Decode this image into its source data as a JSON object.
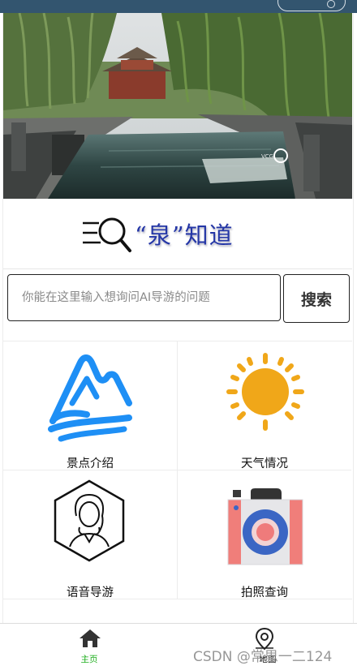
{
  "logo": {
    "text": "“泉”知道"
  },
  "search": {
    "placeholder": "你能在这里输入想询问AI导游的问题",
    "button_label": "搜索"
  },
  "features": [
    {
      "label": "景点介绍",
      "icon": "mountain-icon"
    },
    {
      "label": "天气情况",
      "icon": "sun-icon"
    },
    {
      "label": "语音导游",
      "icon": "guide-avatar-icon"
    },
    {
      "label": "拍照查询",
      "icon": "camera-icon"
    }
  ],
  "tabbar": {
    "items": [
      {
        "label": "主页",
        "icon": "home-icon",
        "active": true
      },
      {
        "label": "地图",
        "icon": "map-pin-icon",
        "active": false
      }
    ]
  },
  "watermark": "CSDN @常思一二124",
  "colors": {
    "accent": "#1aad19",
    "mountain": "#1e8ff5",
    "sun": "#f0a719",
    "logo_text": "#2436a6",
    "topbar": "#33556f"
  }
}
